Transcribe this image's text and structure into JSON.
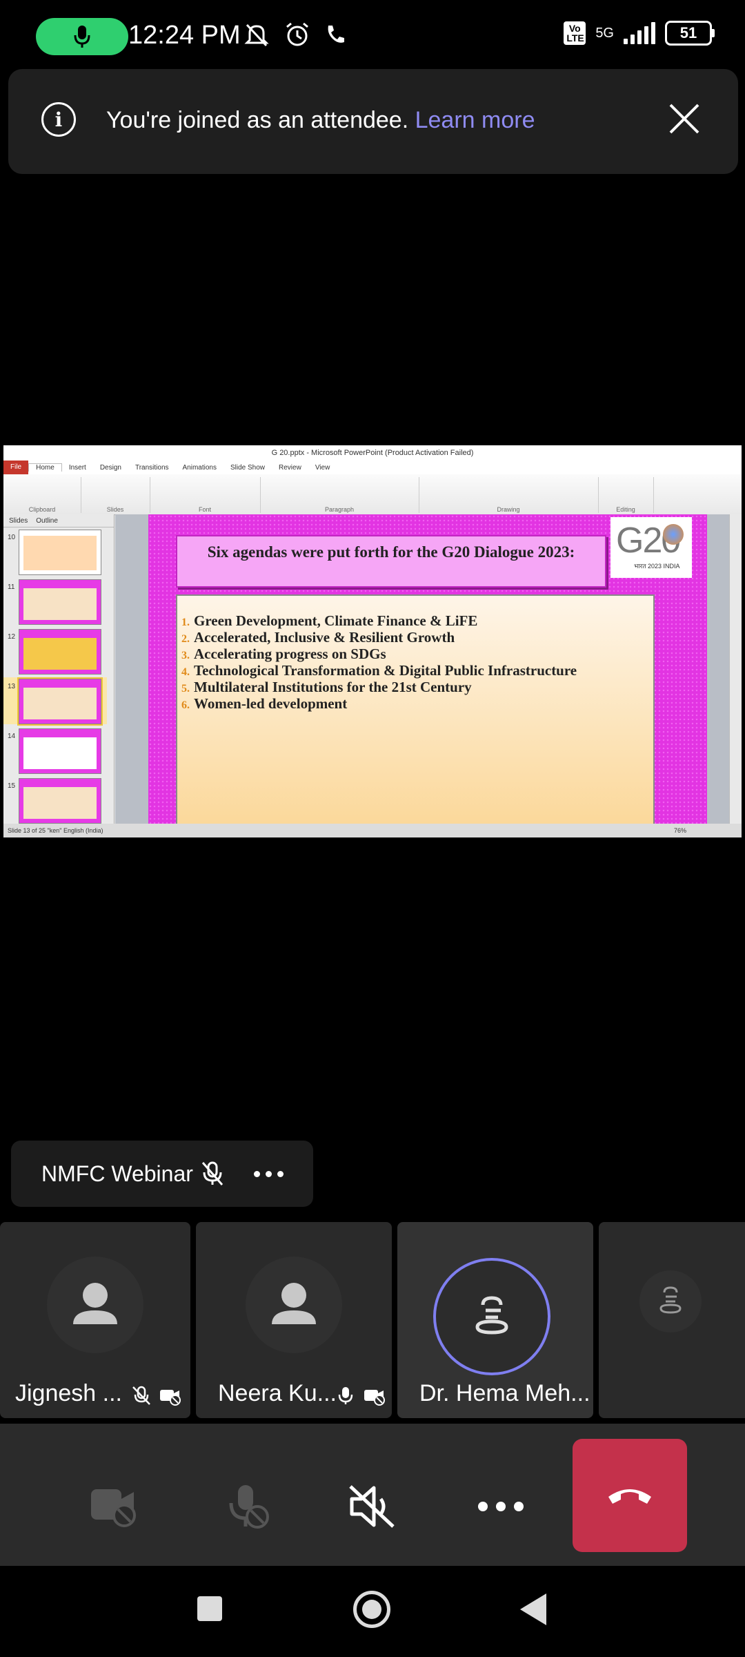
{
  "status_bar": {
    "time": "12:24 PM",
    "network_type": "5G",
    "volte": "Vo LTE",
    "battery": "51"
  },
  "banner": {
    "message": "You're joined as an attendee.",
    "link": "Learn more"
  },
  "shared_screen": {
    "window_title": "G 20.pptx - Microsoft PowerPoint (Product Activation Failed)",
    "ribbon_tabs": [
      "File",
      "Home",
      "Insert",
      "Design",
      "Transitions",
      "Animations",
      "Slide Show",
      "Review",
      "View"
    ],
    "ribbon_groups": [
      "Clipboard",
      "Slides",
      "Font",
      "Paragraph",
      "Drawing",
      "Editing"
    ],
    "left_panel_tabs": [
      "Slides",
      "Outline"
    ],
    "slide_numbers": [
      "10",
      "11",
      "12",
      "13",
      "14",
      "15"
    ],
    "slide_title": "Six agendas were put forth for the G20 Dialogue 2023:",
    "logo_text": "G20",
    "logo_subtext": "भारत 2023 INDIA",
    "agendas": [
      {
        "num": "1.",
        "text": "Green Development, Climate Finance & LiFE"
      },
      {
        "num": "2.",
        "text": "Accelerated, Inclusive & Resilient Growth"
      },
      {
        "num": "3.",
        "text": "Accelerating progress on SDGs"
      },
      {
        "num": "4.",
        "text": "Technological Transformation & Digital Public Infrastructure"
      },
      {
        "num": "5.",
        "text": "Multilateral Institutions for the 21st Century"
      },
      {
        "num": "6.",
        "text": "Women-led development"
      }
    ],
    "status_left": "Slide 13 of 25   \"ken\"   English (India)",
    "zoom": "76%"
  },
  "speaker": {
    "name": "NMFC Webinar"
  },
  "participants": [
    {
      "name": "Jignesh ..."
    },
    {
      "name": "Neera Ku..."
    },
    {
      "name": "Dr. Hema Meh..."
    }
  ],
  "colors": {
    "accent": "#8f8bf2",
    "hangup": "#c4314b",
    "mic_active": "#2fcf6f"
  }
}
